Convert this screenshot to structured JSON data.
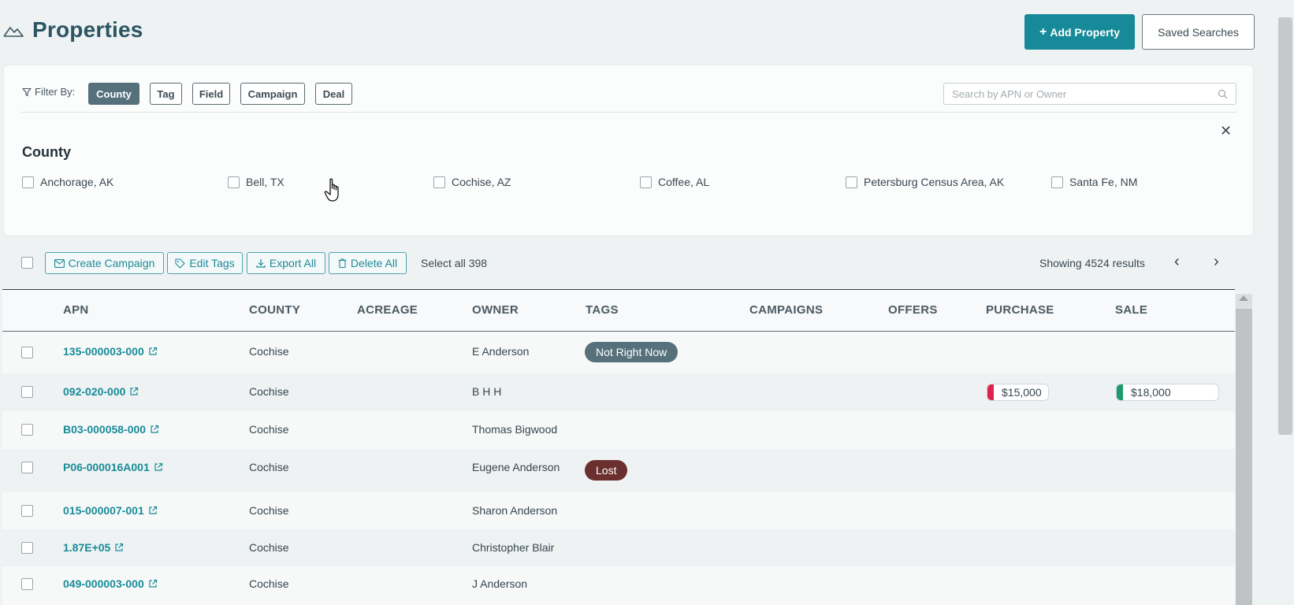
{
  "header": {
    "title": "Properties",
    "add_property_label": "Add Property",
    "saved_searches_label": "Saved Searches"
  },
  "filter": {
    "label": "Filter By:",
    "chips": [
      "County",
      "Tag",
      "Field",
      "Campaign",
      "Deal"
    ],
    "active_chip": "County",
    "search_placeholder": "Search by APN or Owner",
    "section_title": "County",
    "options": [
      "Anchorage, AK",
      "Bell, TX",
      "Cochise, AZ",
      "Coffee, AL",
      "Petersburg Census Area, AK",
      "Santa Fe, NM"
    ]
  },
  "toolbar": {
    "create_campaign": "Create Campaign",
    "edit_tags": "Edit Tags",
    "export_all": "Export All",
    "delete_all": "Delete All",
    "select_all": "Select all 398",
    "showing": "Showing 4524 results"
  },
  "table": {
    "columns": [
      "APN",
      "COUNTY",
      "ACREAGE",
      "OWNER",
      "TAGS",
      "CAMPAIGNS",
      "OFFERS",
      "PURCHASE",
      "SALE"
    ],
    "rows": [
      {
        "apn": "135-000003-000",
        "county": "Cochise",
        "owner": "E Anderson",
        "tag": "Not Right Now",
        "purchase": "",
        "sale": ""
      },
      {
        "apn": "092-020-000",
        "county": "Cochise",
        "owner": "B H H",
        "tag": "",
        "purchase": "$15,000",
        "sale": "$18,000"
      },
      {
        "apn": "B03-000058-000",
        "county": "Cochise",
        "owner": "Thomas Bigwood",
        "tag": "",
        "purchase": "",
        "sale": ""
      },
      {
        "apn": "P06-000016A001",
        "county": "Cochise",
        "owner": "Eugene Anderson",
        "tag": "Lost",
        "purchase": "",
        "sale": ""
      },
      {
        "apn": "015-000007-001",
        "county": "Cochise",
        "owner": "Sharon Anderson",
        "tag": "",
        "purchase": "",
        "sale": ""
      },
      {
        "apn": "1.87E+05",
        "county": "Cochise",
        "owner": "Christopher Blair",
        "tag": "",
        "purchase": "",
        "sale": ""
      },
      {
        "apn": "049-000003-000",
        "county": "Cochise",
        "owner": "J Anderson",
        "tag": "",
        "purchase": "",
        "sale": ""
      }
    ]
  },
  "colors": {
    "accent": "#168a99",
    "tag_not_right_now": "#56707c",
    "tag_lost": "#6b2f2f",
    "purchase_marker": "#e0234e",
    "sale_marker": "#1f9a6e"
  }
}
